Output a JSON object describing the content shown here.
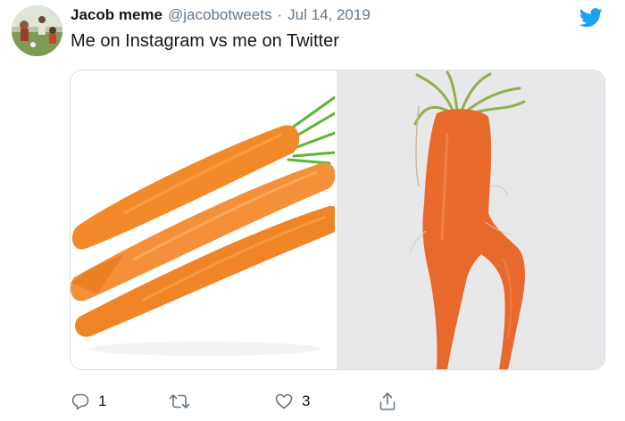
{
  "author": {
    "display_name": "Jacob meme",
    "handle": "@jacobotweets",
    "separator": "·",
    "date": "Jul 14, 2019"
  },
  "tweet": {
    "text": "Me on Instagram vs me on Twitter"
  },
  "media": {
    "left_image": "bunch of straight orange carrots",
    "right_image": "misshapen forked carrot"
  },
  "actions": {
    "reply_count": "1",
    "retweet_count": "",
    "like_count": "3"
  },
  "colors": {
    "twitter_blue": "#1da1f2",
    "secondary_text": "#657786",
    "primary_text": "#14171a",
    "carrot_orange": "#f28a2a"
  },
  "icons": [
    "avatar",
    "twitter-logo-icon",
    "reply-icon",
    "retweet-icon",
    "like-icon",
    "share-icon"
  ]
}
